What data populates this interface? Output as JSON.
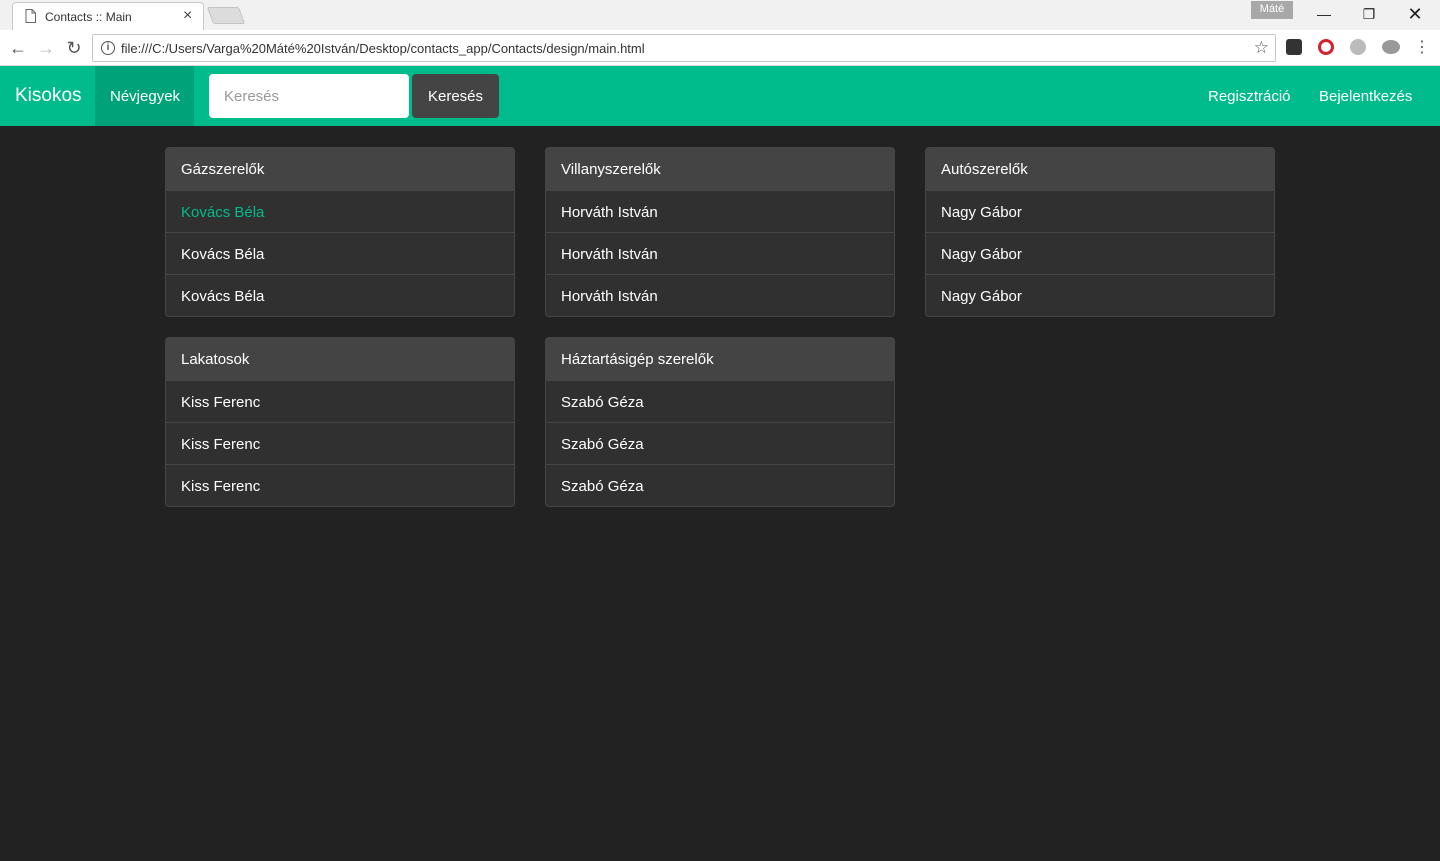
{
  "browser": {
    "tab_title": "Contacts :: Main",
    "url": "file:///C:/Users/Varga%20Máté%20István/Desktop/contacts_app/Contacts/design/main.html",
    "profile": "Máté"
  },
  "navbar": {
    "brand": "Kisokos",
    "active_item": "Névjegyek",
    "search_placeholder": "Keresés",
    "search_button": "Keresés",
    "register": "Regisztráció",
    "login": "Bejelentkezés",
    "colors": {
      "primary": "#00bc8c",
      "active": "#00a379",
      "button": "#444444"
    }
  },
  "panels": [
    {
      "title": "Gázszerelők",
      "items": [
        "Kovács Béla",
        "Kovács Béla",
        "Kovács Béla"
      ]
    },
    {
      "title": "Villanyszerelők",
      "items": [
        "Horváth István",
        "Horváth István",
        "Horváth István"
      ]
    },
    {
      "title": "Autószerelők",
      "items": [
        "Nagy Gábor",
        "Nagy Gábor",
        "Nagy Gábor"
      ]
    },
    {
      "title": "Lakatosok",
      "items": [
        "Kiss Ferenc",
        "Kiss Ferenc",
        "Kiss Ferenc"
      ]
    },
    {
      "title": "Háztartásigép szerelők",
      "items": [
        "Szabó Géza",
        "Szabó Géza",
        "Szabó Géza"
      ]
    }
  ]
}
